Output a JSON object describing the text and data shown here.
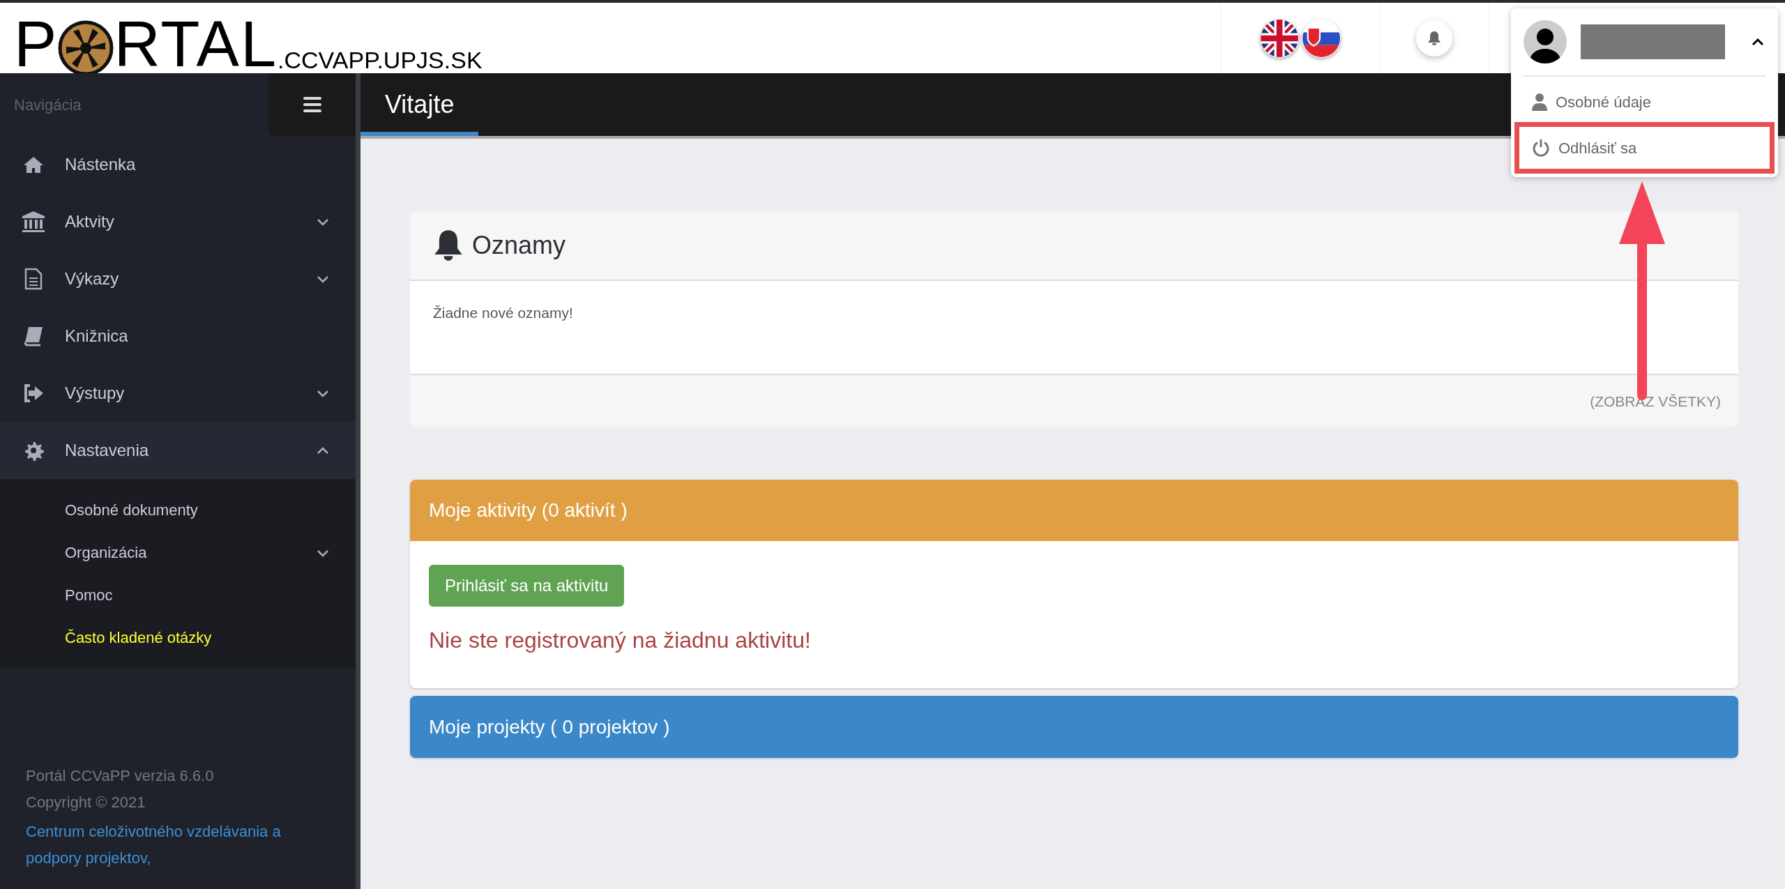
{
  "header": {
    "logo": {
      "start": "P",
      "end": "RTAL",
      "domain": ".CCVAPP.UPJS.SK"
    },
    "languages": [
      {
        "kind": "uk"
      },
      {
        "kind": "sk"
      }
    ],
    "user_menu": {
      "expanded": true,
      "items": [
        {
          "label": "Osobné údaje",
          "kind": "profile",
          "highlighted": false
        },
        {
          "label": "Odhlásiť sa",
          "kind": "logout",
          "highlighted": true
        }
      ]
    }
  },
  "sidebar": {
    "heading": "Navigácia",
    "items": [
      {
        "label": "Nástenka",
        "kind": "home",
        "selected": false
      },
      {
        "label": "Aktvity",
        "kind": "bank",
        "selected": false,
        "expanded": false
      },
      {
        "label": "Výkazy",
        "kind": "file",
        "selected": false,
        "expanded": false
      },
      {
        "label": "Knižnica",
        "kind": "book",
        "selected": false
      },
      {
        "label": "Výstupy",
        "kind": "exit",
        "selected": false,
        "expanded": false
      },
      {
        "label": "Nastavenia",
        "kind": "gear",
        "selected": false,
        "expanded": true,
        "children": [
          {
            "label": "Osobné dokumenty",
            "selected": false
          },
          {
            "label": "Organizácia",
            "selected": false,
            "expanded": false
          },
          {
            "label": "Pomoc",
            "selected": false
          },
          {
            "label": "Často kladené otázky",
            "selected": true
          }
        ]
      }
    ],
    "footer": {
      "version": "Portál CCVaPP verzia 6.6.0",
      "copyright": "Copyright © 2021",
      "link": "Centrum celoživotného vzdelávania a podpory projektov,"
    }
  },
  "page_title": "Vitajte",
  "announcements": {
    "title": "Oznamy",
    "message": "Žiadne nové oznamy!",
    "show_all": "(ZOBRAZ VŠETKY)"
  },
  "activities": {
    "title": "Moje aktivity (0 aktivít )",
    "button": "Prihlásiť sa na aktivitu",
    "message": "Nie ste registrovaný na žiadnu aktivitu!"
  },
  "projects": {
    "title": "Moje projekty ( 0 projektov )"
  }
}
